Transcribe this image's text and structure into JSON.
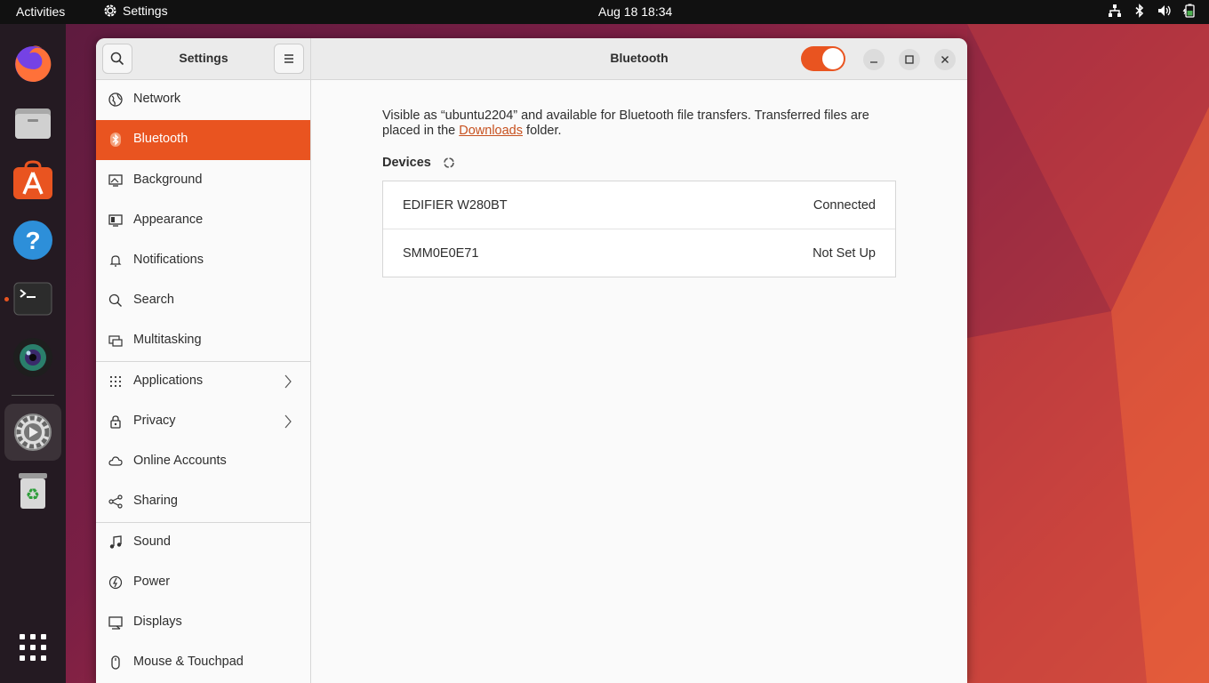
{
  "topbar": {
    "activities": "Activities",
    "app_name": "Settings",
    "clock": "Aug 18  18:34",
    "tray_icons": [
      "network-icon",
      "bluetooth-icon",
      "volume-icon",
      "battery-icon"
    ]
  },
  "dock": {
    "apps": [
      "firefox",
      "files",
      "app-center",
      "help",
      "terminal",
      "camera",
      "settings",
      "trash"
    ],
    "show_apps": "show-applications"
  },
  "window": {
    "sidebar_title": "Settings",
    "page_title": "Bluetooth",
    "bluetooth_enabled": true
  },
  "sidebar": {
    "items": [
      {
        "label": "Network",
        "icon": "globe-icon"
      },
      {
        "label": "Bluetooth",
        "icon": "bluetooth-icon",
        "active": true
      },
      {
        "label": "Background",
        "icon": "background-icon"
      },
      {
        "label": "Appearance",
        "icon": "appearance-icon"
      },
      {
        "label": "Notifications",
        "icon": "bell-icon"
      },
      {
        "label": "Search",
        "icon": "search-icon"
      },
      {
        "label": "Multitasking",
        "icon": "multitasking-icon"
      },
      {
        "label": "Applications",
        "icon": "apps-grid-icon",
        "chevron": true
      },
      {
        "label": "Privacy",
        "icon": "lock-icon",
        "chevron": true
      },
      {
        "label": "Online Accounts",
        "icon": "cloud-icon"
      },
      {
        "label": "Sharing",
        "icon": "share-icon"
      },
      {
        "label": "Sound",
        "icon": "music-note-icon"
      },
      {
        "label": "Power",
        "icon": "power-icon"
      },
      {
        "label": "Displays",
        "icon": "display-icon"
      },
      {
        "label": "Mouse & Touchpad",
        "icon": "mouse-icon"
      }
    ]
  },
  "content": {
    "desc_part1": "Visible as “ubuntu2204” and available for Bluetooth file transfers. Transferred files are placed in the ",
    "desc_link": "Downloads",
    "desc_part2": " folder.",
    "devices_label": "Devices",
    "devices": [
      {
        "name": "EDIFIER W280BT",
        "status": "Connected"
      },
      {
        "name": "SMM0E0E71",
        "status": "Not Set Up"
      }
    ]
  }
}
